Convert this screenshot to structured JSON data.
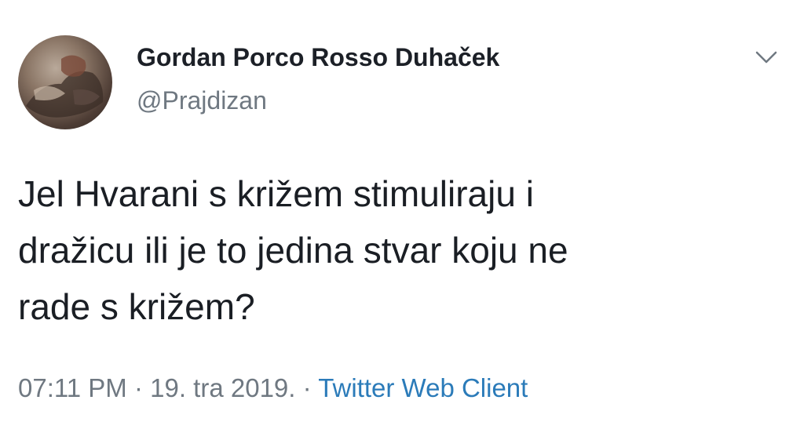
{
  "author": {
    "display_name": "Gordan Porco Rosso Duhaček",
    "handle": "@Prajdizan"
  },
  "tweet": {
    "text_lines": [
      "Jel Hvarani s križem stimuliraju i",
      "dražicu ili je to jedina stvar koju ne",
      "rade s križem?"
    ]
  },
  "meta": {
    "time": "07:11 PM",
    "separator_1": " · ",
    "date": "19. tra 2019.",
    "separator_2": " · ",
    "source": "Twitter Web Client"
  },
  "icons": {
    "menu": "chevron-down-icon"
  },
  "colors": {
    "secondary_text": "#6f7881",
    "link": "#2b7bb9"
  }
}
